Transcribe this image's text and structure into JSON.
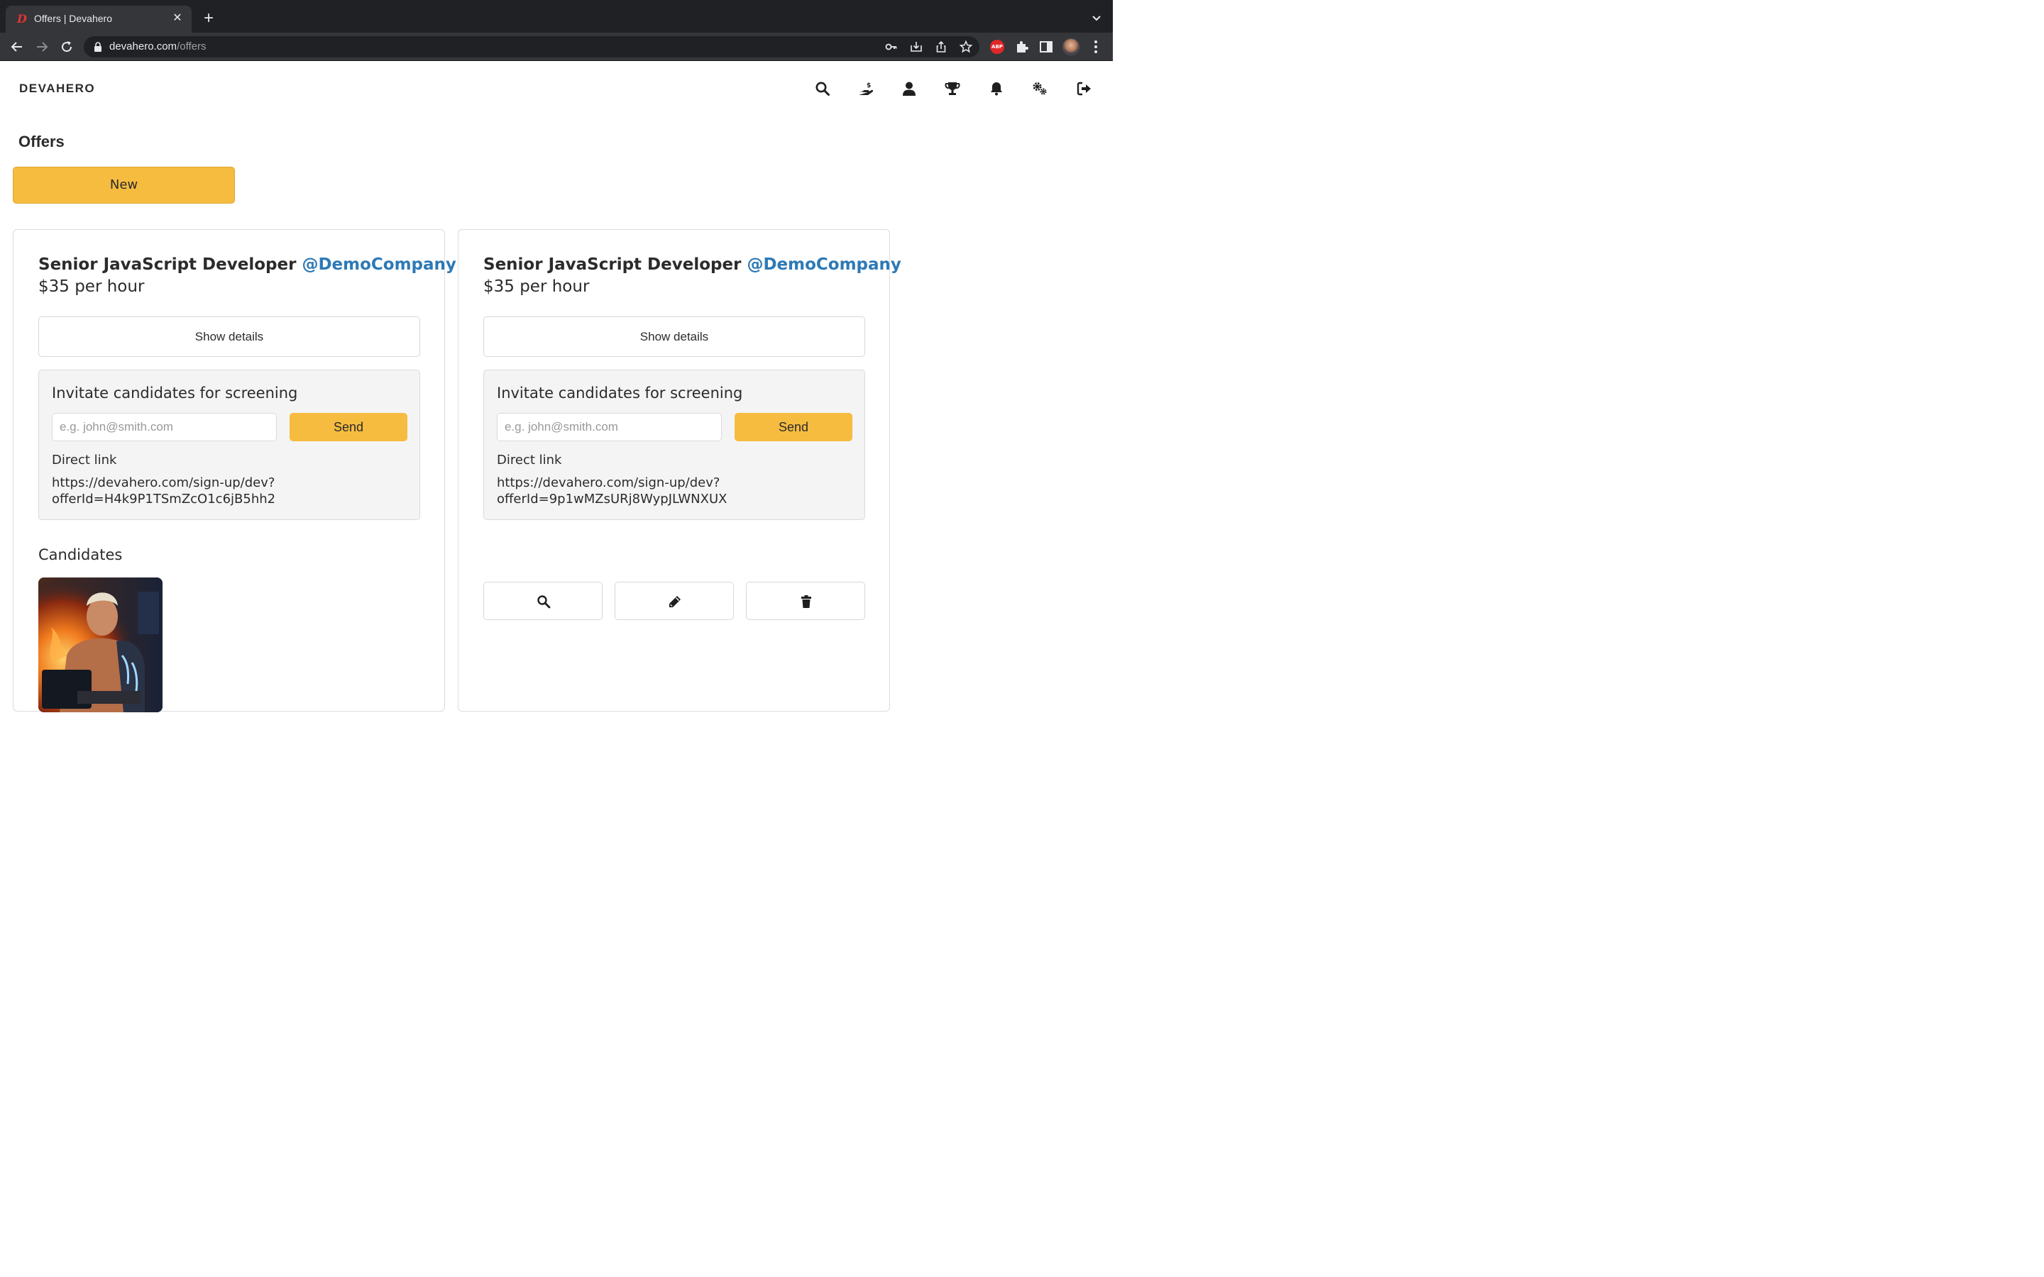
{
  "browser": {
    "tab_title": "Offers | Devahero",
    "tab_favicon": "D",
    "url_host": "devahero.com",
    "url_path": "/offers",
    "abp_label": "ABP"
  },
  "app": {
    "logo": "DEVAHERO",
    "nav_icons": [
      "search-icon",
      "hand-holding-dollar-icon",
      "user-icon",
      "trophy-icon",
      "bell-icon",
      "gears-icon",
      "sign-out-icon"
    ]
  },
  "page": {
    "title": "Offers",
    "new_button": "New"
  },
  "offers": [
    {
      "title": "Senior JavaScript Developer",
      "company": "@DemoCompany",
      "rate": "$35 per hour",
      "show_details": "Show details",
      "invite_title": "Invitate candidates for screening",
      "email_placeholder": "e.g. john@smith.com",
      "send_label": "Send",
      "direct_link_label": "Direct link",
      "direct_link_line1": "https://devahero.com/sign-up/dev?",
      "direct_link_line2": "offerId=H4k9P1TSmZcO1c6jB5hh2",
      "candidates_title": "Candidates"
    },
    {
      "title": "Senior JavaScript Developer",
      "company": "@DemoCompany",
      "rate": "$35 per hour",
      "show_details": "Show details",
      "invite_title": "Invitate candidates for screening",
      "email_placeholder": "e.g. john@smith.com",
      "send_label": "Send",
      "direct_link_label": "Direct link",
      "direct_link_line1": "https://devahero.com/sign-up/dev?",
      "direct_link_line2": "offerId=9p1wMZsURj8WypJLWNXUX",
      "actions": [
        "search-icon",
        "pencil-icon",
        "trash-icon"
      ]
    }
  ],
  "colors": {
    "accent": "#f6bc40",
    "link": "#2d79b6",
    "text": "#2b2b2b"
  }
}
